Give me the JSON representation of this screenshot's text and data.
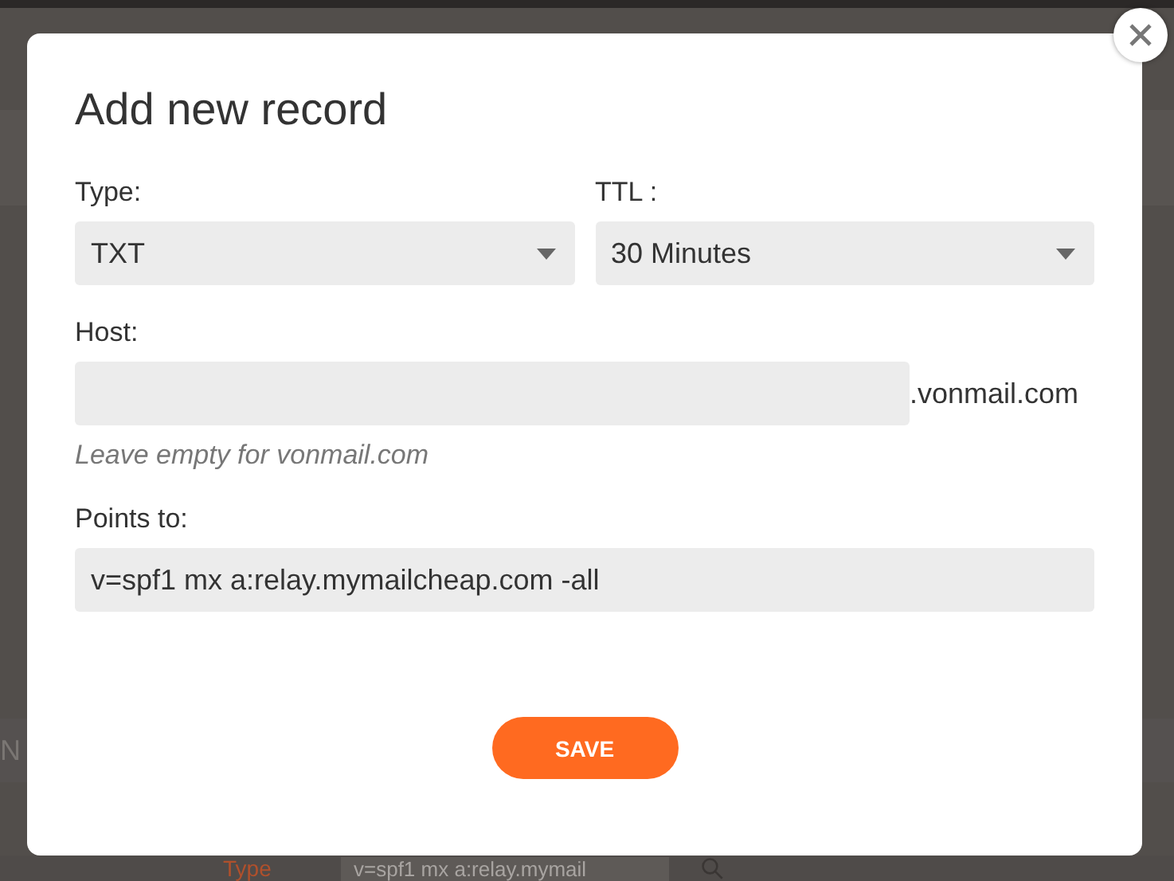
{
  "background": {
    "lower_left_fragment": "N",
    "bottom_label": "Type",
    "bottom_field_value": "v=spf1 mx a:relay.mymail"
  },
  "dialog": {
    "title": "Add new record",
    "type": {
      "label": "Type:",
      "value": "TXT"
    },
    "ttl": {
      "label": "TTL :",
      "value": "30 Minutes"
    },
    "host": {
      "label": "Host:",
      "suffix": ".vonmail.com",
      "hint": "Leave empty for vonmail.com"
    },
    "points_to": {
      "label": "Points to:",
      "value": "v=spf1 mx a:relay.mymailcheap.com -all"
    },
    "save_button": "SAVE"
  }
}
